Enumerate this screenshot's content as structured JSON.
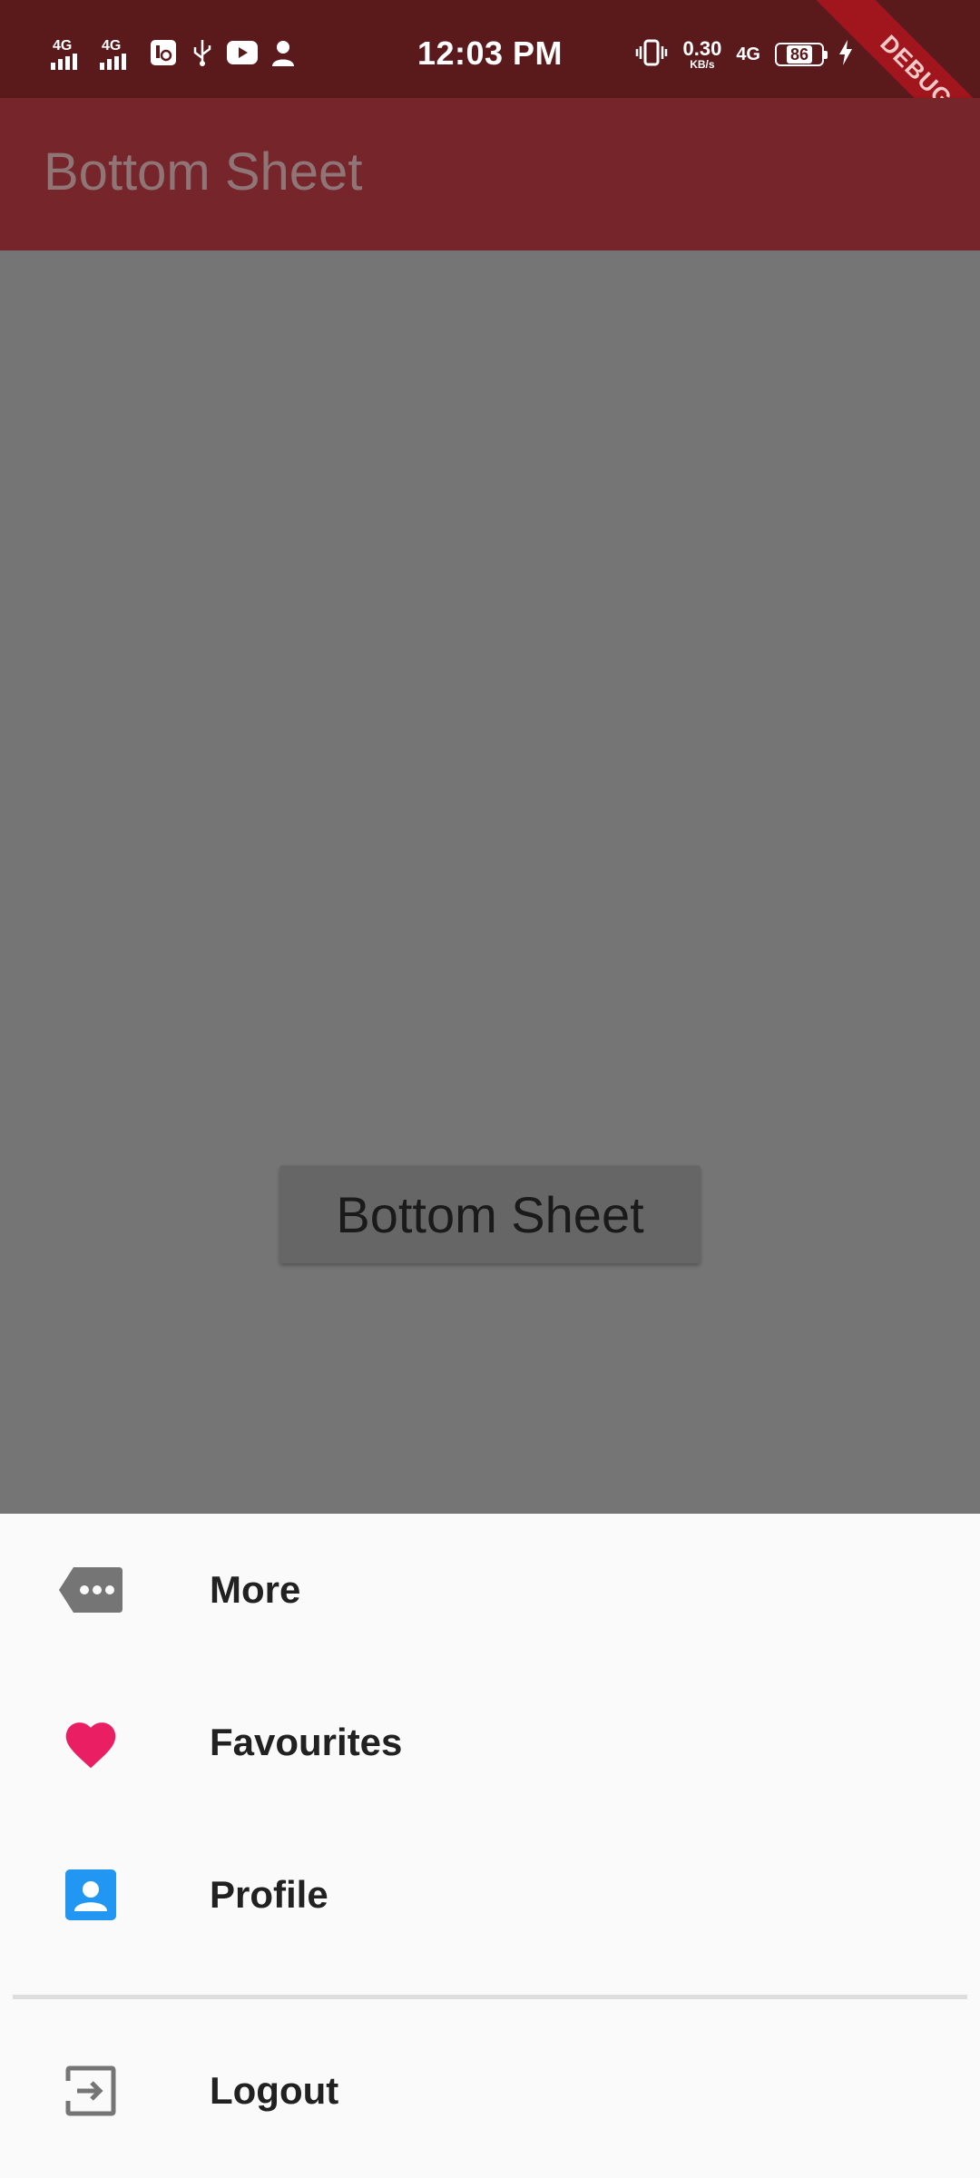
{
  "status_bar": {
    "time": "12:03 PM",
    "signal_1": "4G",
    "signal_2": "4G",
    "net_speed_value": "0.30",
    "net_speed_unit": "KB/s",
    "network_type": "4G",
    "battery_level": "86",
    "icons": [
      "signal-icon",
      "signal-icon",
      "sim-manager-icon",
      "usb-icon",
      "youtube-icon",
      "add-user-icon",
      "vibrate-icon",
      "network-4g-icon",
      "battery-icon",
      "charging-icon"
    ]
  },
  "debug_banner": "DEBUG",
  "app_bar": {
    "title": "Bottom Sheet"
  },
  "main": {
    "button_label": "Bottom Sheet"
  },
  "bottom_sheet": {
    "items": [
      {
        "label": "More",
        "icon": "more-tag-icon",
        "icon_color": "#757575"
      },
      {
        "label": "Favourites",
        "icon": "heart-icon",
        "icon_color": "#e91e63"
      },
      {
        "label": "Profile",
        "icon": "account-box-icon",
        "icon_color": "#2196f3"
      },
      {
        "label": "Logout",
        "icon": "exit-icon",
        "icon_color": "#757575"
      }
    ]
  },
  "colors": {
    "status_bar": "#5a1a1c",
    "app_bar": "#76262a",
    "scrim": "#757575",
    "sheet": "#fafafa"
  }
}
